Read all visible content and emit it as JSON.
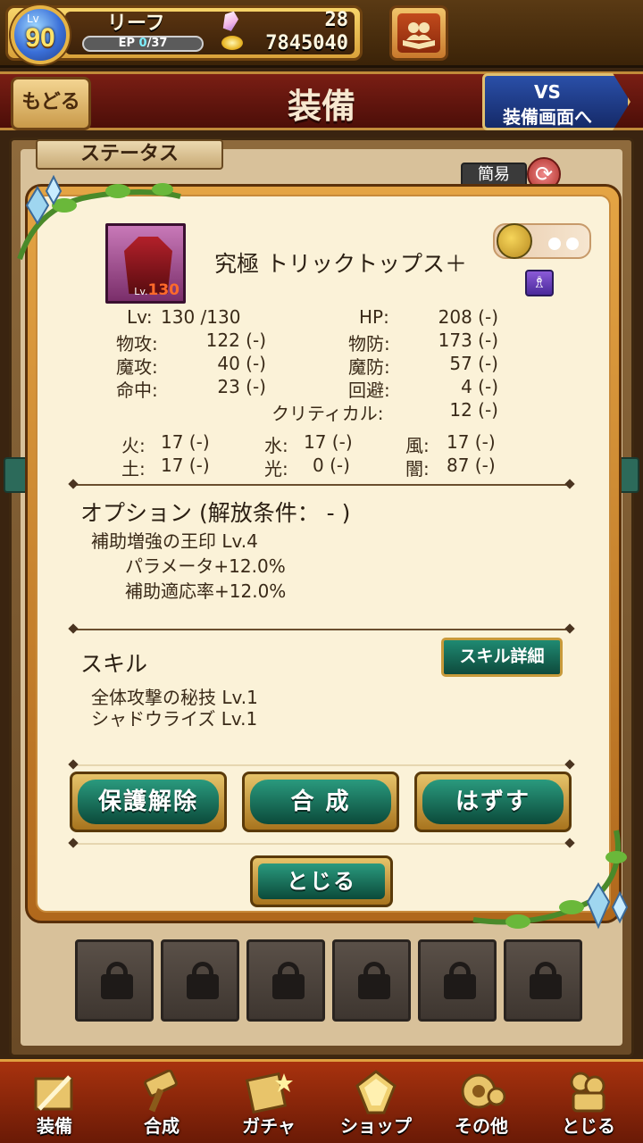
{
  "player": {
    "lv_caption": "Lv",
    "level": "90",
    "name": "リーフ",
    "ep_label": "EP",
    "ep_current": "0",
    "ep_max": "/37",
    "crystals": "28",
    "gold": "7845040"
  },
  "header": {
    "back_label": "もどる",
    "title": "装備",
    "vs_line1": "VS",
    "vs_line2": "装備画面へ"
  },
  "background": {
    "status_tab": "ステータス",
    "simple_label": "簡易"
  },
  "item": {
    "name": "究極 トリックトップス＋",
    "thumb_lv_caption": "Lv.",
    "thumb_lv": "130"
  },
  "stats": {
    "lv_label": "Lv:",
    "lv_value": "130 /130",
    "hp_label": "HP:",
    "hp_value": "208 (-)",
    "patk_label": "物攻:",
    "patk_value": "122 (-)",
    "pdef_label": "物防:",
    "pdef_value": "173 (-)",
    "matk_label": "魔攻:",
    "matk_value": "40 (-)",
    "mdef_label": "魔防:",
    "mdef_value": "57 (-)",
    "acc_label": "命中:",
    "acc_value": "23 (-)",
    "eva_label": "回避:",
    "eva_value": "4 (-)",
    "crit_label": "クリティカル:",
    "crit_value": "12 (-)"
  },
  "elements": {
    "fire_label": "火:",
    "fire_value": "17 (-)",
    "water_label": "水:",
    "water_value": "17 (-)",
    "wind_label": "風:",
    "wind_value": "17 (-)",
    "earth_label": "土:",
    "earth_value": "17 (-)",
    "light_label": "光:",
    "light_value": "0 (-)",
    "dark_label": "闇:",
    "dark_value": "87 (-)"
  },
  "options": {
    "title": "オプション (解放条件： - )",
    "lines": [
      "補助増強の王印 Lv.4",
      "パラメータ+12.0%",
      "補助適応率+12.0%"
    ]
  },
  "skills": {
    "title": "スキル",
    "detail_button": "スキル詳細",
    "lines": [
      "全体攻撃の秘技  Lv.1",
      "シャドウライズ  Lv.1"
    ]
  },
  "actions": {
    "unprotect": "保護解除",
    "synthesize": "合 成",
    "remove": "はずす",
    "close": "とじる"
  },
  "nav": {
    "items": [
      "装備",
      "合成",
      "ガチャ",
      "ショップ",
      "その他",
      "とじる"
    ]
  },
  "colors": {
    "accent_teal": "#0e4a3c",
    "gold_trim": "#c89a3a",
    "parchment": "#fbf2d8"
  }
}
